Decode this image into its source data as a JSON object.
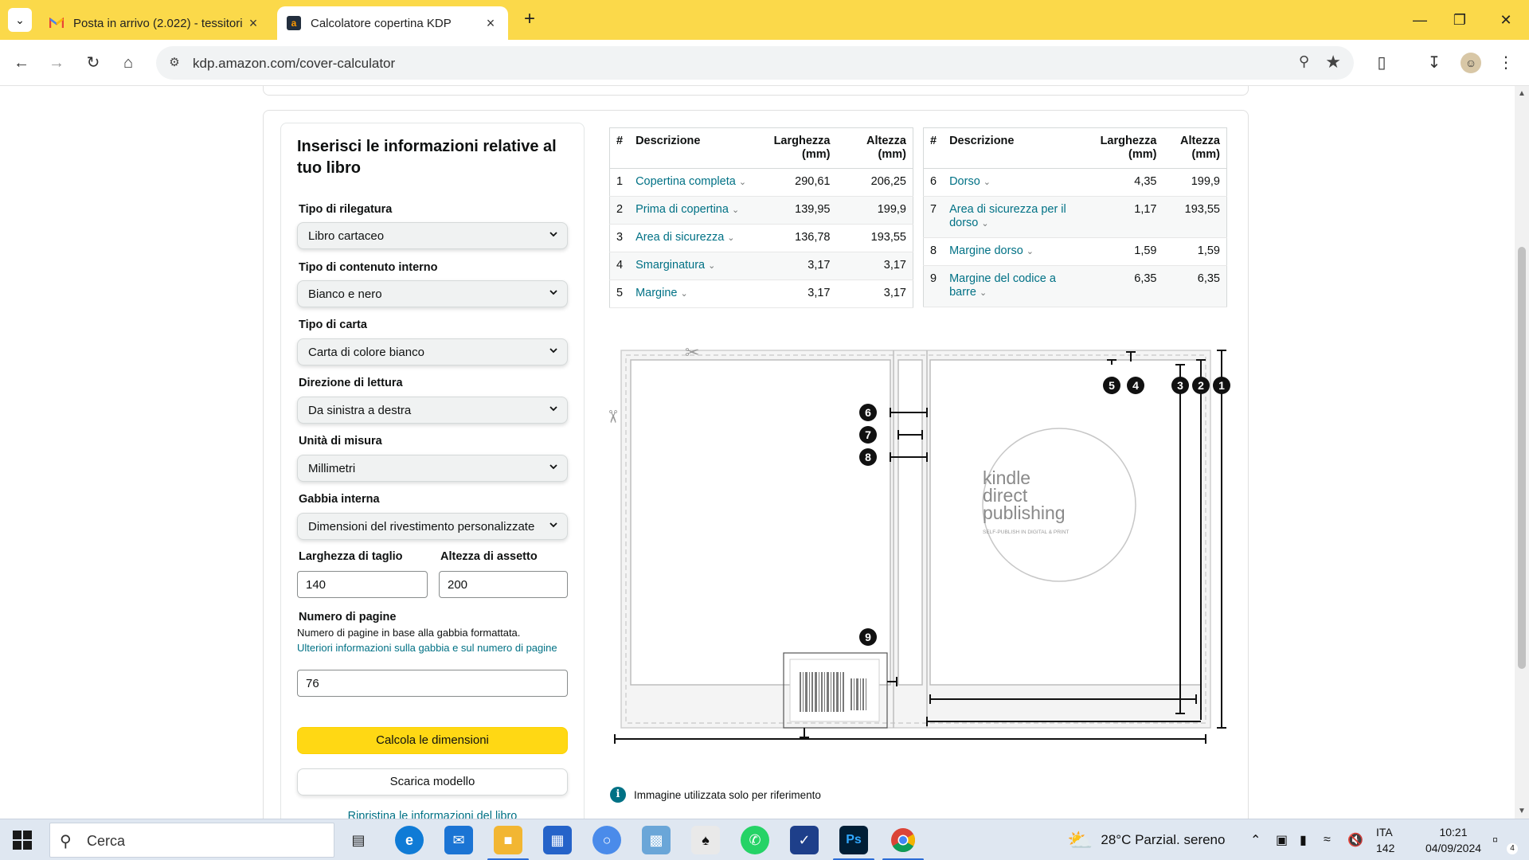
{
  "browser": {
    "tabs": [
      {
        "title": "Posta in arrivo (2.022) - tessitori",
        "favicon": "gmail-icon",
        "active": false
      },
      {
        "title": "Calcolatore copertina KDP",
        "favicon": "amazon-icon",
        "active": true
      }
    ],
    "url": "kdp.amazon.com/cover-calculator"
  },
  "form": {
    "heading": "Inserisci le informazioni relative al tuo libro",
    "binding_label": "Tipo di rilegatura",
    "binding_value": "Libro cartaceo",
    "interior_label": "Tipo di contenuto interno",
    "interior_value": "Bianco e nero",
    "paper_label": "Tipo di carta",
    "paper_value": "Carta di colore bianco",
    "reading_label": "Direzione di lettura",
    "reading_value": "Da sinistra a destra",
    "unit_label": "Unità di misura",
    "unit_value": "Millimetri",
    "trim_label": "Gabbia interna",
    "trim_value": "Dimensioni del rivestimento personalizzate",
    "width_label": "Larghezza di taglio",
    "width_value": "140",
    "height_label": "Altezza di assetto",
    "height_value": "200",
    "pages_label": "Numero di pagine",
    "pages_help": "Numero di pagine in base alla gabbia formattata.",
    "pages_link": "Ulteriori informazioni sulla gabbia e sul numero di pagine",
    "pages_value": "76",
    "calc_button": "Calcola le dimensioni",
    "download_button": "Scarica modello",
    "reset_link": "Ripristina le informazioni del libro"
  },
  "table_headers": {
    "idx": "#",
    "desc": "Descrizione",
    "width": "Larghezza (mm)",
    "height": "Altezza (mm)"
  },
  "table_left": [
    {
      "idx": "1",
      "desc": "Copertina completa",
      "width": "290,61",
      "height": "206,25"
    },
    {
      "idx": "2",
      "desc": "Prima di copertina",
      "width": "139,95",
      "height": "199,9"
    },
    {
      "idx": "3",
      "desc": "Area di sicurezza",
      "width": "136,78",
      "height": "193,55"
    },
    {
      "idx": "4",
      "desc": "Smarginatura",
      "width": "3,17",
      "height": "3,17"
    },
    {
      "idx": "5",
      "desc": "Margine",
      "width": "3,17",
      "height": "3,17"
    }
  ],
  "table_right": [
    {
      "idx": "6",
      "desc": "Dorso",
      "width": "4,35",
      "height": "199,9"
    },
    {
      "idx": "7",
      "desc": "Area di sicurezza per il dorso",
      "width": "1,17",
      "height": "193,55"
    },
    {
      "idx": "8",
      "desc": "Margine dorso",
      "width": "1,59",
      "height": "1,59"
    },
    {
      "idx": "9",
      "desc": "Margine del codice a barre",
      "width": "6,35",
      "height": "6,35"
    }
  ],
  "diagram": {
    "markers": [
      "1",
      "2",
      "3",
      "4",
      "5",
      "6",
      "7",
      "8",
      "9"
    ],
    "logo_line1": "kindle",
    "logo_line2": "direct",
    "logo_line3": "publishing",
    "logo_tagline": "SELF-PUBLISH IN DIGITAL & PRINT",
    "note": "Immagine utilizzata solo per riferimento"
  },
  "taskbar": {
    "search_placeholder": "Cerca",
    "weather": "28°C  Parzial. sereno",
    "language_top": "ITA",
    "language_bottom": "142",
    "time": "10:21",
    "date": "04/09/2024",
    "notification_count": "4"
  }
}
